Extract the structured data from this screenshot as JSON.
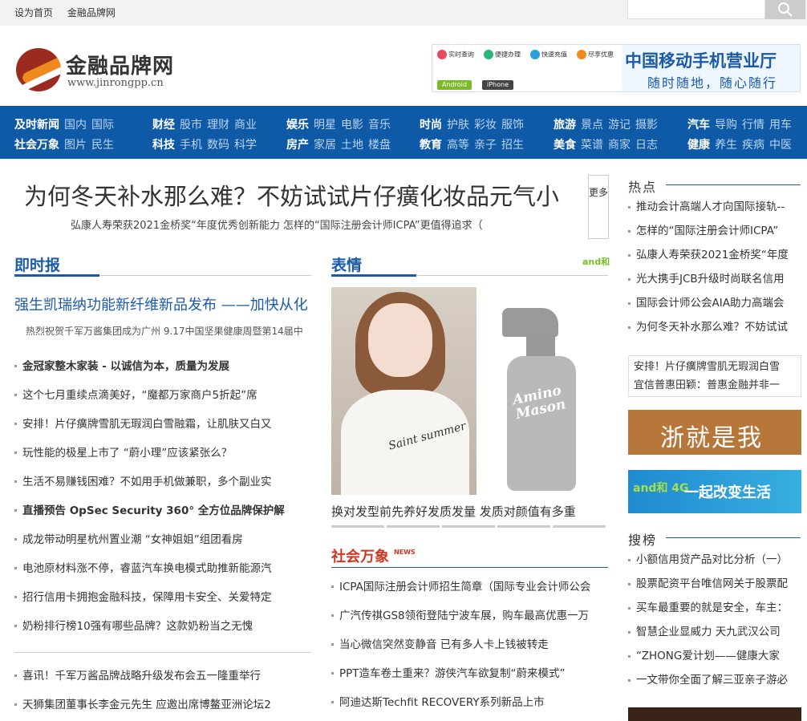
{
  "topbar": {
    "links": [
      "设为首页",
      "金融品牌网"
    ]
  },
  "search": {
    "placeholder": ""
  },
  "logo": {
    "cn": "金融品牌网",
    "en": "www.jinrongpp.cn"
  },
  "ad_top": {
    "icons": [
      "实时查询",
      "便捷办理",
      "快速充值",
      "尽享优惠"
    ],
    "pills": [
      "Android",
      "iPhone"
    ],
    "title": "中国移动手机营业厅",
    "subtitle": "随时随地，随心随行"
  },
  "nav": {
    "groups": [
      {
        "rows": [
          {
            "head": "及时新闻",
            "items": [
              "国内",
              "国际"
            ]
          },
          {
            "head": "社会万象",
            "items": [
              "图片",
              "民生"
            ]
          }
        ]
      },
      {
        "rows": [
          {
            "head": "财经",
            "items": [
              "股市",
              "理财",
              "商业"
            ]
          },
          {
            "head": "科技",
            "items": [
              "手机",
              "数码",
              "科学"
            ]
          }
        ]
      },
      {
        "rows": [
          {
            "head": "娱乐",
            "items": [
              "明星",
              "电影",
              "音乐"
            ]
          },
          {
            "head": "房产",
            "items": [
              "家居",
              "土地",
              "楼盘"
            ]
          }
        ]
      },
      {
        "rows": [
          {
            "head": "时尚",
            "items": [
              "护肤",
              "彩妆",
              "服饰"
            ]
          },
          {
            "head": "教育",
            "items": [
              "高等",
              "亲子",
              "招生"
            ]
          }
        ]
      },
      {
        "rows": [
          {
            "head": "旅游",
            "items": [
              "景点",
              "游记",
              "摄影"
            ]
          },
          {
            "head": "美食",
            "items": [
              "菜谱",
              "商家",
              "日志"
            ]
          }
        ]
      },
      {
        "rows": [
          {
            "head": "汽车",
            "items": [
              "导购",
              "行情",
              "用车"
            ]
          },
          {
            "head": "健康",
            "items": [
              "养生",
              "疾病",
              "中医"
            ]
          }
        ]
      }
    ]
  },
  "headline": {
    "title": "为何冬天补水那么难？不妨试试片仔癀化妆品元气小",
    "sub": "弘康人寿荣获2021金桥奖“年度优秀创新能力 怎样的“国际注册会计师ICPA”更值得追求（",
    "more": "更多"
  },
  "col1": {
    "title": "即时报",
    "feature_title": "强生凯瑞纳功能新纤维新品发布 ——加快从化",
    "feature_sub": "热烈祝贺千军万酱集团成为广州 9.17中国坚果健康周暨第14届中",
    "items": [
      {
        "text": "金冠家整木家装 - 以诚信为本，质量为发展",
        "bold": true
      },
      {
        "text": "这个七月重续点滴美好，“魔都万家商户5折起”席",
        "bold": false
      },
      {
        "text": "安排！片仔癀牌雪肌无瑕润白雪融霜，让肌肤又白又",
        "bold": false
      },
      {
        "text": "玩性能的极星上市了 “蔚小理”应该紧张么？",
        "bold": false
      },
      {
        "text": "生活不易赚钱困难？不如用手机做兼职，多个副业实",
        "bold": false
      },
      {
        "text": "直播预告 OpSec Security 360° 全方位品牌保护解",
        "bold": true
      },
      {
        "text": "成龙带动明星杭州置业潮 “女神姐姐”组团看房",
        "bold": false
      },
      {
        "text": "电池原材料涨不停，睿蓝汽车换电模式助推新能源汽",
        "bold": false
      },
      {
        "text": "招行信用卡拥抱金融科技，保障用卡安全、关爱特定",
        "bold": false
      },
      {
        "text": "奶粉排行榜10强有哪些品牌？这款奶粉当之无愧",
        "bold": false
      }
    ],
    "items2": [
      "喜讯！千军万酱品牌战略升级发布会五一隆重举行",
      "天狮集团董事长李金元先生 应邀出席博鳌亚洲论坛2"
    ]
  },
  "col2": {
    "title": "表情",
    "brand": "and和",
    "shirt_text": "Saint summer",
    "bottle_text": "Amino Mason",
    "caption": "换对发型前先养好发质发量 发质对颜值有多重",
    "section2_title": "社会万象",
    "section2_tag": "NEWS",
    "items": [
      "ICPA国际注册会计师招生简章（国际专业会计师公会",
      "广汽传祺GS8领衔登陆宁波车展，购车最高优惠一万",
      "当心微信突然变静音 已有多人卡上钱被转走",
      "PPT造车卷土重来？游侠汽车欲复制“蔚来模式”",
      "阿迪达斯Techfit RECOVERY系列新品上市"
    ]
  },
  "right": {
    "hot_title": "热点",
    "hot_items": [
      "推动会计高端人才向国际接轨--",
      "怎样的“国际注册会计师ICPA”",
      "弘康人寿荣获2021金桥奖“年度",
      "光大携手JCB升级时尚联名信用",
      "国际会计师公会AIA助力高端会",
      "为何冬天补水那么难？不妨试试"
    ],
    "box_lines": [
      "安排！片仔癀牌雪肌无瑕润白雪",
      "宜信普惠田颖：普惠金融并非一"
    ],
    "banner1": "浙就是我",
    "banner2_brand": "and和 4G",
    "banner2_text": "一起改变生活",
    "search_title": "搜榜",
    "search_items": [
      "小额信用贷产品对比分析（一）",
      "股票配资平台唯信网关于股票配",
      "买车最重要的就是安全，车主：",
      "智慧企业显威力 天九武汉公司",
      "“ZHONG爱计划——健康大家",
      "一文带你全面了解三亚亲子游必"
    ]
  }
}
